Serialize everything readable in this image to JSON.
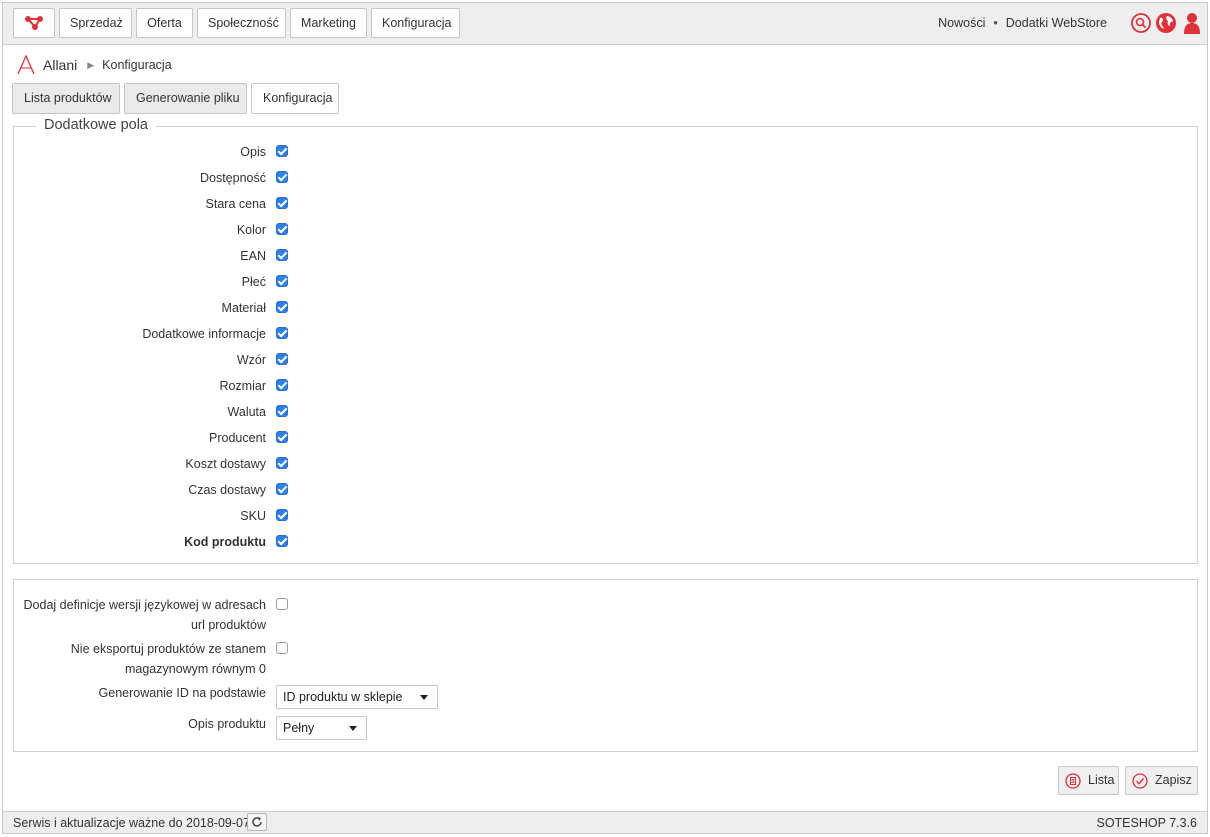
{
  "topbar": {
    "nav": [
      "Sprzedaż",
      "Oferta",
      "Społeczność",
      "Marketing",
      "Konfiguracja"
    ],
    "links": [
      "Nowości",
      "Dodatki WebStore"
    ]
  },
  "breadcrumb": {
    "root": "Allani",
    "current": "Konfiguracja"
  },
  "tabs": [
    "Lista produktów",
    "Generowanie pliku",
    "Konfiguracja"
  ],
  "fields": {
    "legend": "Dodatkowe pola",
    "items": [
      {
        "label": "Opis",
        "checked": true
      },
      {
        "label": "Dostępność",
        "checked": true
      },
      {
        "label": "Stara cena",
        "checked": true
      },
      {
        "label": "Kolor",
        "checked": true
      },
      {
        "label": "EAN",
        "checked": true
      },
      {
        "label": "Płeć",
        "checked": true
      },
      {
        "label": "Materiał",
        "checked": true
      },
      {
        "label": "Dodatkowe informacje",
        "checked": true
      },
      {
        "label": "Wzór",
        "checked": true
      },
      {
        "label": "Rozmiar",
        "checked": true
      },
      {
        "label": "Waluta",
        "checked": true
      },
      {
        "label": "Producent",
        "checked": true
      },
      {
        "label": "Koszt dostawy",
        "checked": true
      },
      {
        "label": "Czas dostawy",
        "checked": true
      },
      {
        "label": "SKU",
        "checked": true
      },
      {
        "label": "Kod produktu",
        "checked": true
      }
    ]
  },
  "options": {
    "lang_def_line1": "Dodaj definicje wersji językowej w adresach",
    "lang_def_line2": "url produktów",
    "lang_def_checked": false,
    "no_export_line1": "Nie eksportuj produktów ze stanem",
    "no_export_line2": "magazynowym równym 0",
    "no_export_checked": false,
    "id_label": "Generowanie ID na podstawie",
    "id_value": "ID produktu w sklepie",
    "desc_label": "Opis produktu",
    "desc_value": "Pełny"
  },
  "actions": {
    "list": "Lista",
    "save": "Zapisz"
  },
  "footer": {
    "service": "Serwis i aktualizacje ważne do 2018-09-07",
    "version": "SOTESHOP 7.3.6"
  },
  "colors": {
    "accent": "#e0303a",
    "checkbox": "#2f80e5"
  }
}
